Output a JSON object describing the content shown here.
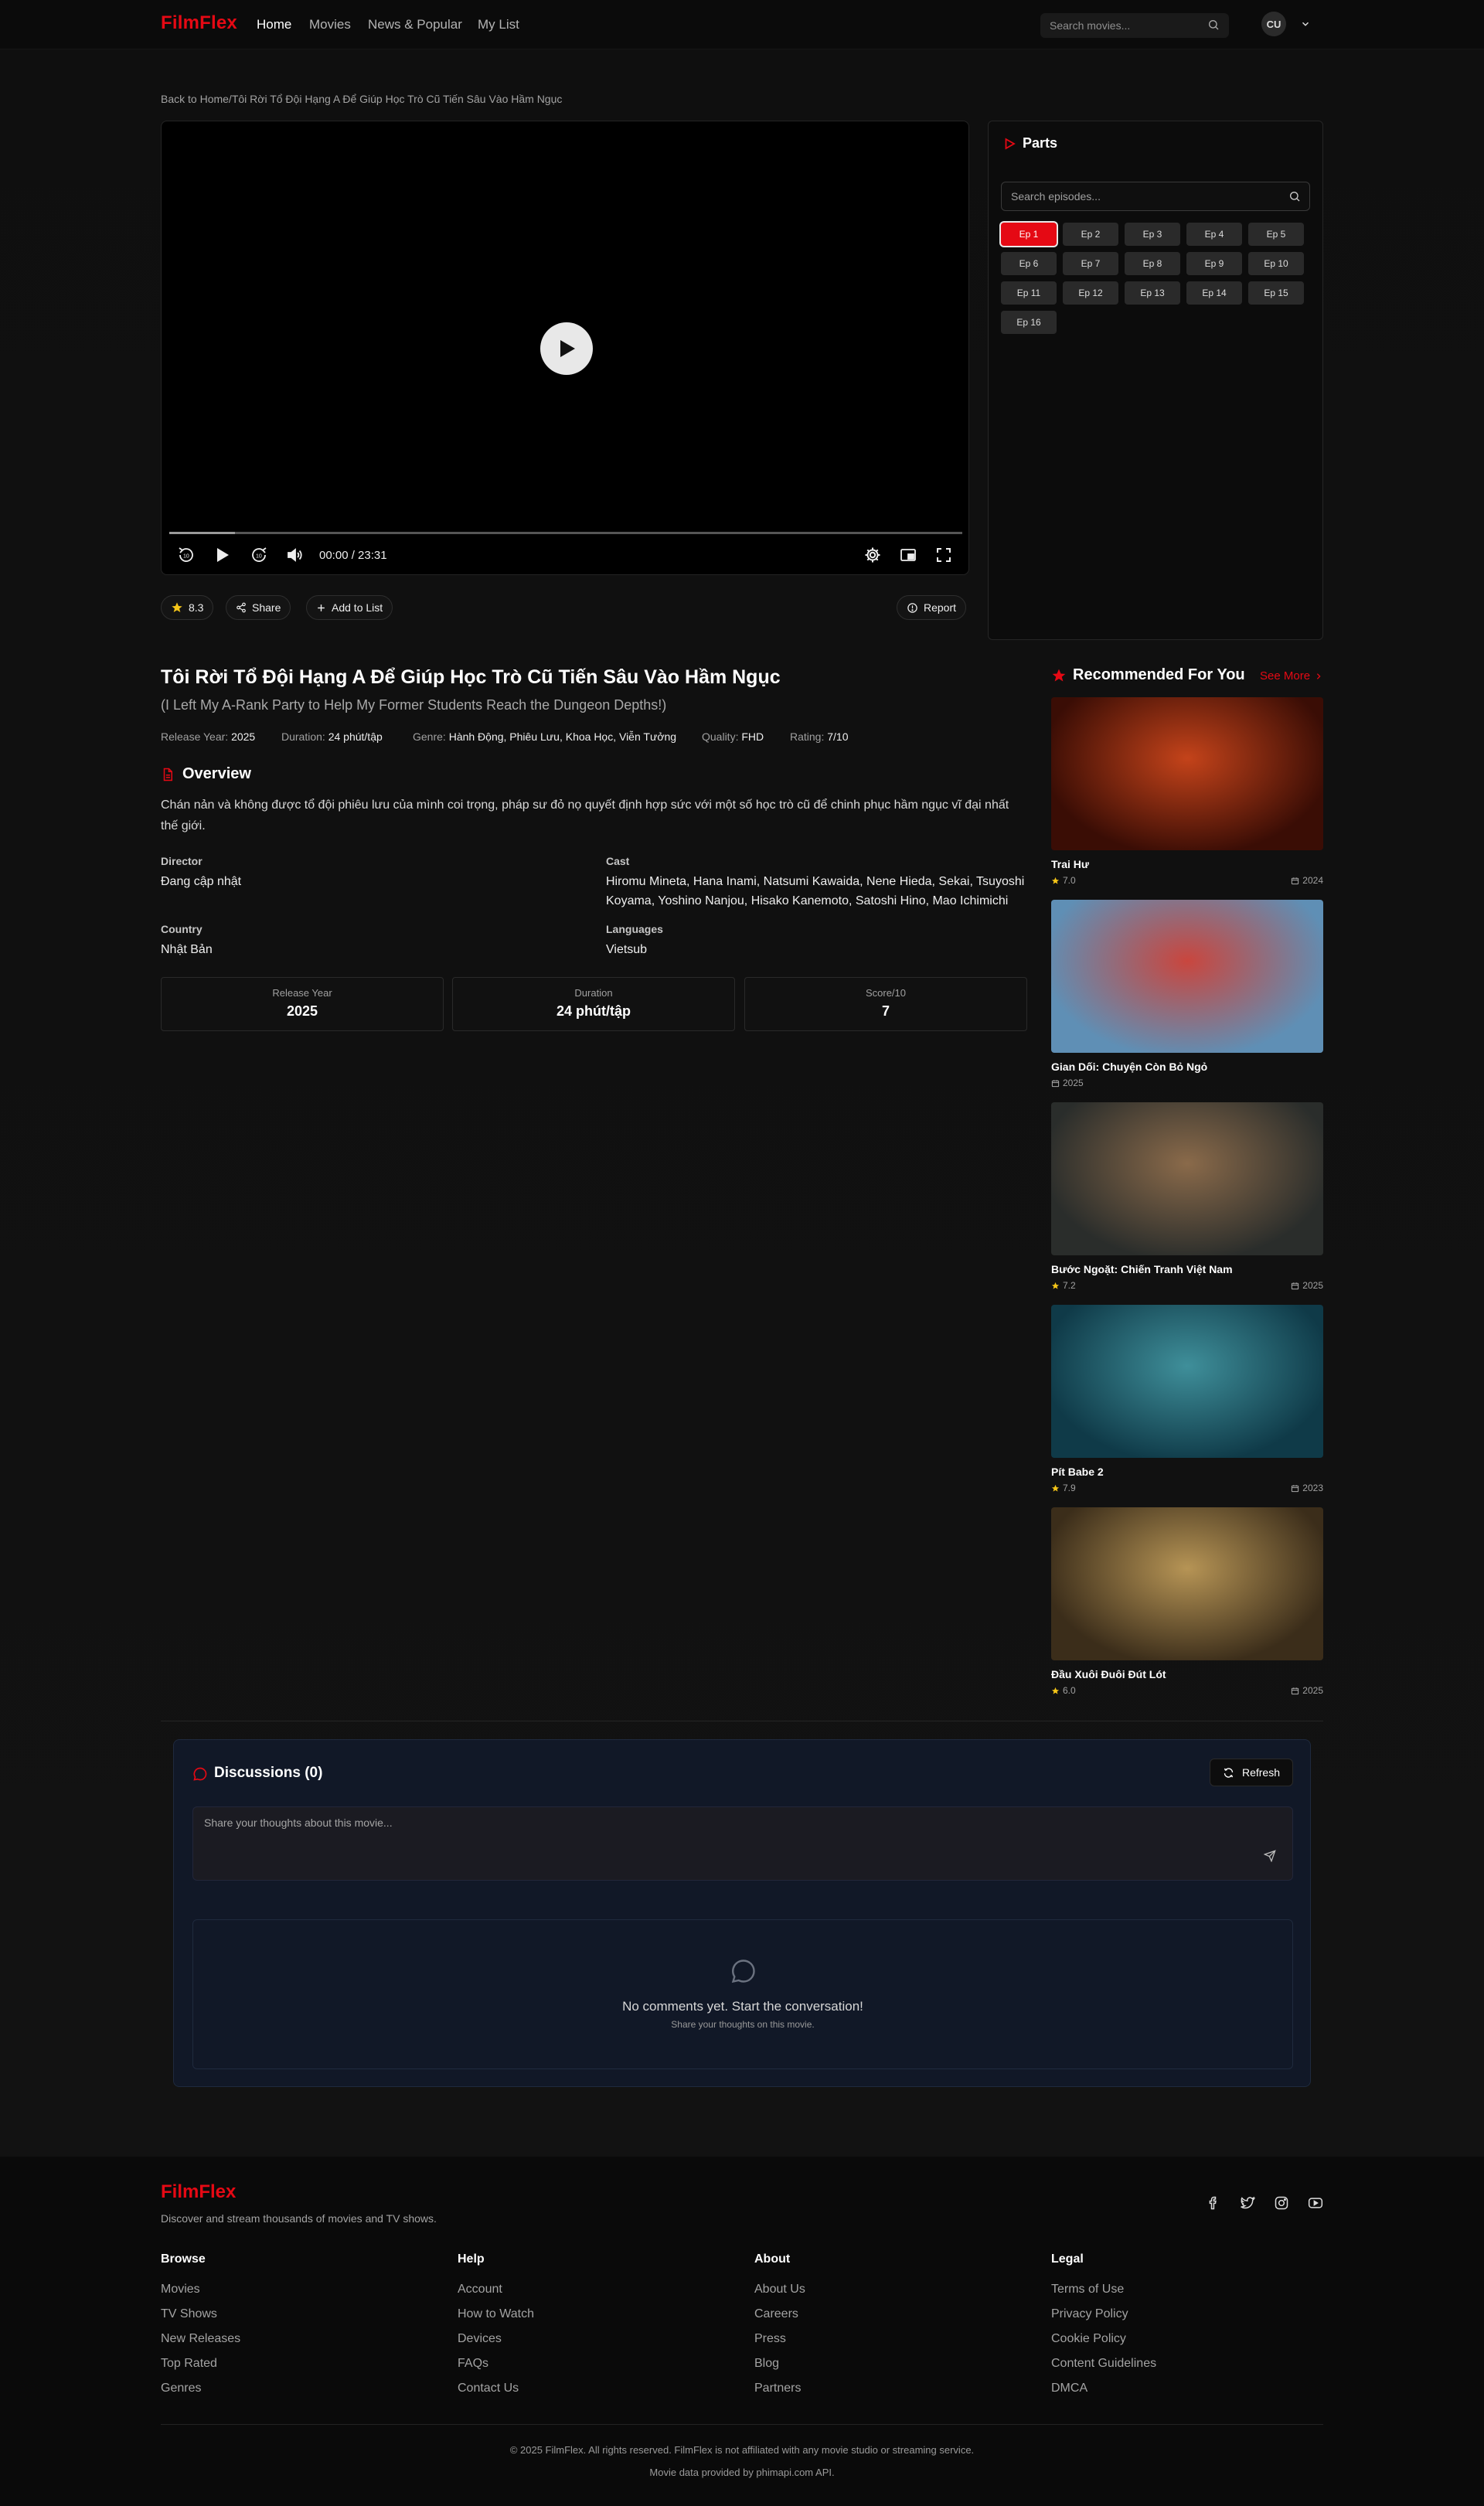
{
  "header": {
    "logo": "FilmFlex",
    "nav": [
      "Home",
      "Movies",
      "News & Popular",
      "My List"
    ],
    "active_nav": "Home",
    "search_placeholder": "Search movies...",
    "avatar_initials": "CU"
  },
  "breadcrumb": "Back to Home/Tôi Rời Tổ Đội Hạng A Để Giúp Học Trò Cũ Tiến Sâu Vào Hầm Ngục",
  "player": {
    "time": "00:00 / 23:31",
    "buffered_fraction": 0.083
  },
  "parts": {
    "title": "Parts",
    "search_placeholder": "Search episodes...",
    "episodes": [
      "Ep 1",
      "Ep 2",
      "Ep 3",
      "Ep 4",
      "Ep 5",
      "Ep 6",
      "Ep 7",
      "Ep 8",
      "Ep 9",
      "Ep 10",
      "Ep 11",
      "Ep 12",
      "Ep 13",
      "Ep 14",
      "Ep 15",
      "Ep 16"
    ],
    "active_episode": "Ep 1"
  },
  "actions": {
    "rating": "8.3",
    "share": "Share",
    "add_to_list": "Add to List",
    "report": "Report"
  },
  "movie": {
    "title": "Tôi Rời Tổ Đội Hạng A Để Giúp Học Trò Cũ Tiến Sâu Vào Hầm Ngục",
    "original_title": "(I Left My A-Rank Party to Help My Former Students Reach the Dungeon Depths!)",
    "meta": [
      {
        "label": "Release Year:",
        "value": "2025"
      },
      {
        "label": "Duration:",
        "value": "24 phút/tập"
      },
      {
        "label": "Genre:",
        "value": "Hành Động, Phiêu Lưu, Khoa Học, Viễn Tưởng"
      },
      {
        "label": "Quality:",
        "value": "FHD"
      },
      {
        "label": "Rating:",
        "value": "7/10"
      }
    ],
    "overview_heading": "Overview",
    "overview": "Chán nản và không được tổ đội phiêu lưu của mình coi trọng, pháp sư đỏ nọ quyết định hợp sức với một số học trò cũ để chinh phục hầm ngục vĩ đại nhất thế giới.",
    "director_label": "Director",
    "director": "Đang cập nhật",
    "cast_label": "Cast",
    "cast_line1": "Hiromu Mineta, Hana Inami, Natsumi Kawaida, Nene Hieda, Sekai, Tsuyoshi",
    "cast_line2": "Koyama, Yoshino Nanjou, Hisako Kanemoto, Satoshi Hino, Mao Ichimichi",
    "country_label": "Country",
    "country": "Nhật Bản",
    "languages_label": "Languages",
    "languages": "Vietsub",
    "stats": [
      {
        "label": "Release Year",
        "value": "2025"
      },
      {
        "label": "Duration",
        "value": "24 phút/tập"
      },
      {
        "label": "Score/10",
        "value": "7"
      }
    ]
  },
  "recommended": {
    "title": "Recommended For You",
    "see_more": "See More",
    "items": [
      {
        "name": "Trai Hư",
        "score": "7.0",
        "year": "2024",
        "palette": [
          "#3a0d05",
          "#c4431a"
        ]
      },
      {
        "name": "Gian Dối: Chuyện Còn Bỏ Ngỏ",
        "score": "",
        "year": "2025",
        "palette": [
          "#5f8fb5",
          "#c9463e"
        ]
      },
      {
        "name": "Bước Ngoặt: Chiến Tranh Việt Nam",
        "score": "7.2",
        "year": "2025",
        "palette": [
          "#2a2d2b",
          "#8a6a4a"
        ]
      },
      {
        "name": "Pít Babe 2",
        "score": "7.9",
        "year": "2023",
        "palette": [
          "#0f3a48",
          "#3f8f9a"
        ]
      },
      {
        "name": "Đầu Xuôi Đuôi Đút Lót",
        "score": "6.0",
        "year": "2025",
        "palette": [
          "#3b2d1a",
          "#b69455"
        ]
      }
    ]
  },
  "discussions": {
    "title": "Discussions (0)",
    "refresh": "Refresh",
    "placeholder": "Share your thoughts about this movie...",
    "empty_title": "No comments yet. Start the conversation!",
    "empty_sub": "Share your thoughts on this movie."
  },
  "footer": {
    "logo": "FilmFlex",
    "tagline": "Discover and stream thousands of movies and TV shows.",
    "columns": [
      {
        "heading": "Browse",
        "links": [
          "Movies",
          "TV Shows",
          "New Releases",
          "Top Rated",
          "Genres"
        ]
      },
      {
        "heading": "Help",
        "links": [
          "Account",
          "How to Watch",
          "Devices",
          "FAQs",
          "Contact Us"
        ]
      },
      {
        "heading": "About",
        "links": [
          "About Us",
          "Careers",
          "Press",
          "Blog",
          "Partners"
        ]
      },
      {
        "heading": "Legal",
        "links": [
          "Terms of Use",
          "Privacy Policy",
          "Cookie Policy",
          "Content Guidelines",
          "DMCA"
        ]
      }
    ],
    "copyright": "© 2025 FilmFlex. All rights reserved. FilmFlex is not affiliated with any movie studio or streaming service.",
    "provided": "Movie data provided by phimapi.com API.",
    "social_icons": [
      "facebook-icon",
      "twitter-icon",
      "instagram-icon",
      "youtube-icon"
    ]
  },
  "colors": {
    "accent": "#e50914",
    "background": "#121212",
    "panel": "#111827"
  }
}
